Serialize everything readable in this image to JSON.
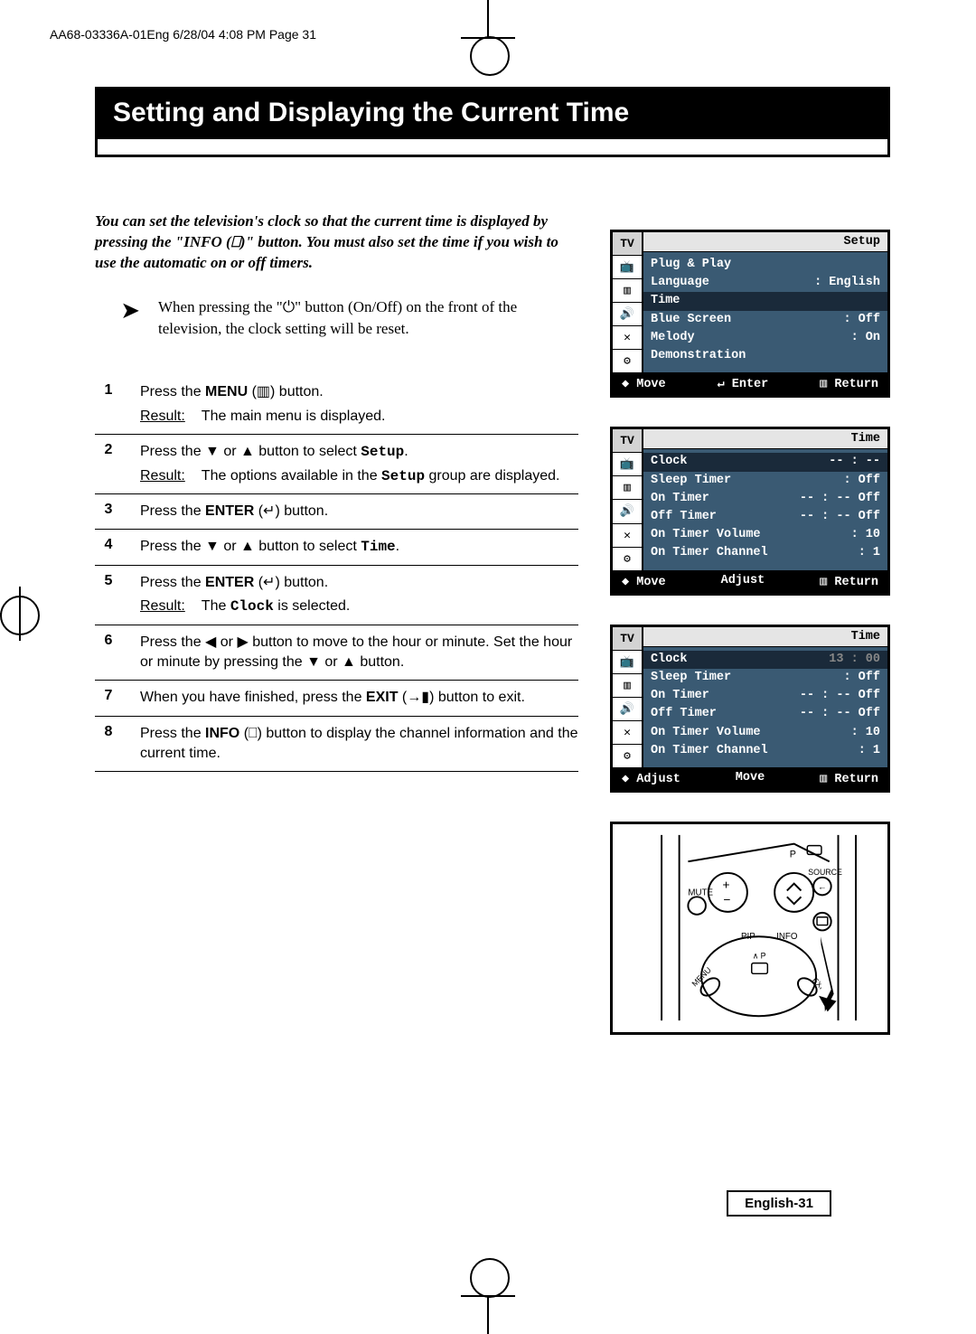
{
  "printHeader": "AA68-03336A-01Eng  6/28/04  4:08 PM  Page 31",
  "title": "Setting and Displaying the Current Time",
  "intro": "You can set the television's clock so that the current time is displayed by pressing the \"INFO (⎕)\" button. You must also set the time if you wish to use the automatic on or off timers.",
  "note": "When pressing the \"⏻\" button (On/Off) on the front of the television, the clock setting will be reset.",
  "steps": [
    {
      "num": "1",
      "body": "Press the MENU (▥) button.",
      "result": "The main menu is displayed."
    },
    {
      "num": "2",
      "body_pre": "Press the ▼ or ▲ button to select ",
      "body_mono": "Setup",
      "body_post": ".",
      "result_pre": "The options available in the ",
      "result_mono": "Setup",
      "result_post": " group are displayed."
    },
    {
      "num": "3",
      "body": "Press the ENTER (↵) button."
    },
    {
      "num": "4",
      "body_pre": "Press the ▼ or ▲ button to select ",
      "body_mono": "Time",
      "body_post": "."
    },
    {
      "num": "5",
      "body": "Press the ENTER (↵) button.",
      "result_pre": "The ",
      "result_mono": "Clock",
      "result_post": " is selected."
    },
    {
      "num": "6",
      "body": "Press the ◀ or ▶ button to move to the hour or minute. Set the hour or minute by pressing the ▼ or ▲ button."
    },
    {
      "num": "7",
      "body": "When you have finished, press the EXIT (→▮) button to exit."
    },
    {
      "num": "8",
      "body": "Press the INFO (⎕) button to display the channel information and the current time."
    }
  ],
  "osd1": {
    "title": "Setup",
    "rows": [
      {
        "l": "Plug & Play",
        "r": ""
      },
      {
        "l": "Language",
        "r": ": English"
      },
      {
        "l": "Time",
        "r": "",
        "hl": true
      },
      {
        "l": "Blue Screen",
        "r": ": Off"
      },
      {
        "l": "Melody",
        "r": ": On"
      },
      {
        "l": "Demonstration",
        "r": ""
      }
    ],
    "footer": [
      "◆ Move",
      "↵ Enter",
      "▥ Return"
    ]
  },
  "osd2": {
    "title": "Time",
    "rows": [
      {
        "l": "Clock",
        "r": "-- : --",
        "hl": true
      },
      {
        "l": "Sleep Timer",
        "r": ": Off"
      },
      {
        "l": "On Timer",
        "r": "-- : -- Off"
      },
      {
        "l": "Off Timer",
        "r": "-- : -- Off"
      },
      {
        "l": "On Timer Volume",
        "r": ": 10"
      },
      {
        "l": "On Timer Channel",
        "r": ": 1"
      }
    ],
    "footer": [
      "◆ Move",
      "Adjust",
      "▥ Return"
    ]
  },
  "osd3": {
    "title": "Time",
    "rows": [
      {
        "l": "Clock",
        "r": "13 : 00",
        "hl": true,
        "rgrey": true
      },
      {
        "l": "Sleep Timer",
        "r": ": Off"
      },
      {
        "l": "On Timer",
        "r": "-- : -- Off"
      },
      {
        "l": "Off Timer",
        "r": "-- : -- Off"
      },
      {
        "l": "On Timer Volume",
        "r": ": 10"
      },
      {
        "l": "On Timer Channel",
        "r": ": 1"
      }
    ],
    "footer": [
      "◆ Adjust",
      "Move",
      "▥ Return"
    ]
  },
  "sidebarIcons": [
    "TV",
    "📺",
    "▥",
    "🔊",
    "✕",
    "⚙"
  ],
  "remote": {
    "labels": [
      "P",
      "SOURCE",
      "MUTE",
      "PIP",
      "INFO",
      "MENU",
      "EXIT"
    ]
  },
  "pageFooter": "English-31",
  "resultLabel": "Result:"
}
